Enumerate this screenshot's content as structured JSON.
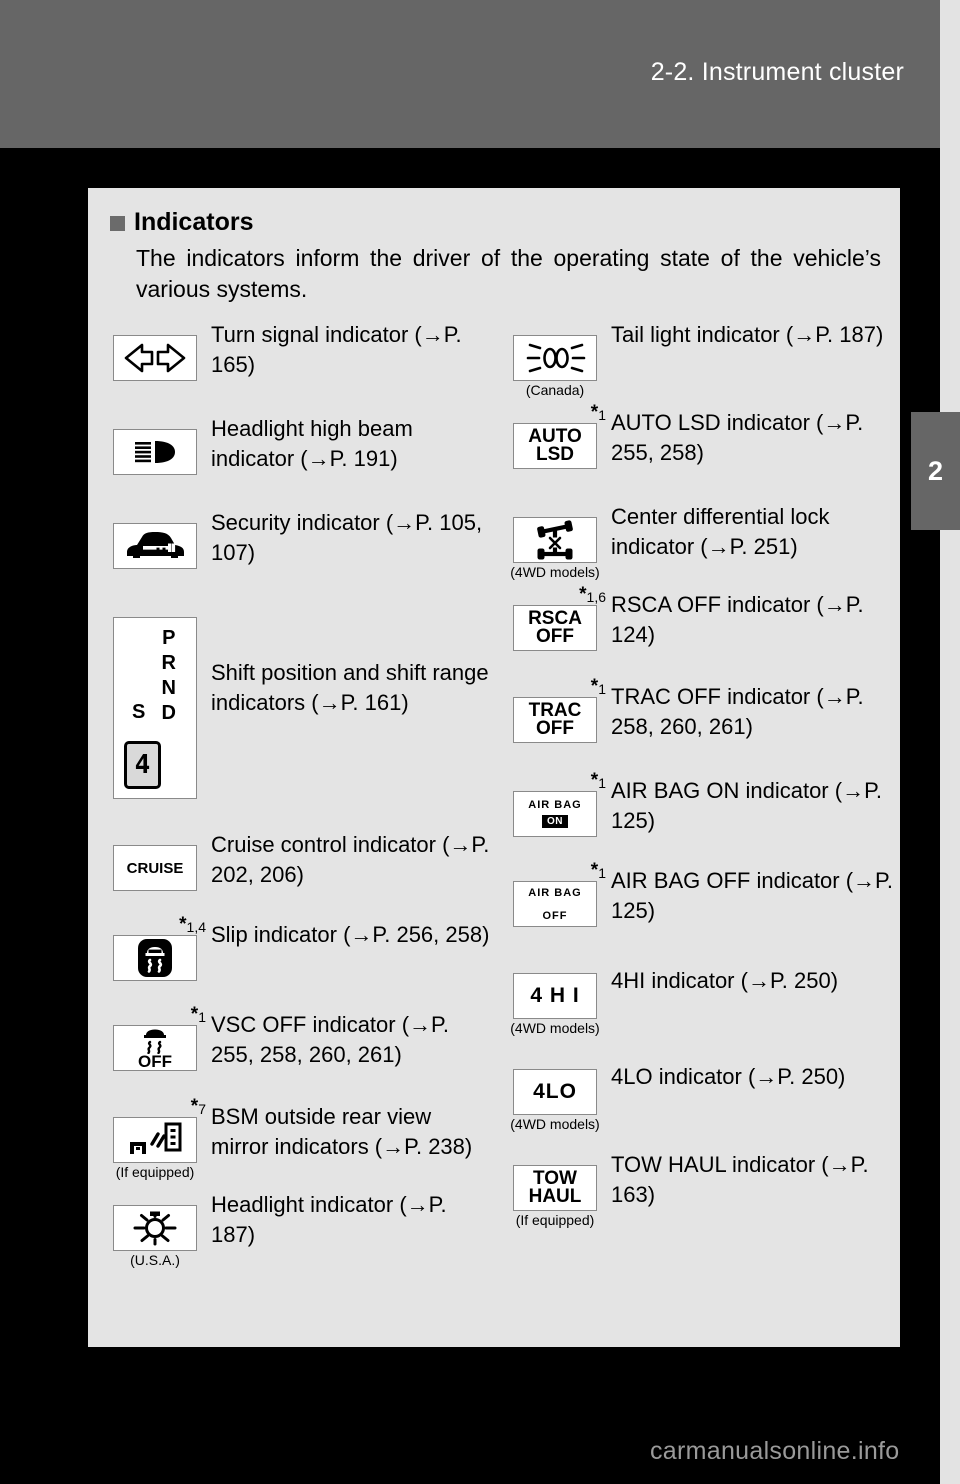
{
  "header": {
    "title": "2-2. Instrument cluster",
    "chapter_number": "2"
  },
  "section": {
    "title": "Indicators",
    "body": "The indicators inform the driver of the operating state of the vehicle’s various systems."
  },
  "left_column": [
    {
      "icon": "turn-signal-icon",
      "note": "",
      "sub": "",
      "label": "Turn signal indicator (→P. 165)"
    },
    {
      "icon": "high-beam-icon",
      "note": "",
      "sub": "",
      "label": "Headlight high beam indicator (→P. 191)"
    },
    {
      "icon": "security-icon",
      "note": "",
      "sub": "",
      "label": "Security indicator (→P. 105, 107)"
    },
    {
      "icon": "shift-position-icon",
      "note": "",
      "sub": "",
      "label": "Shift position and shift range indicators (→P. 161)",
      "glyph_letters": "P\nR\nN\nD",
      "glyph_s": "S",
      "glyph_gear": "4"
    },
    {
      "icon": "cruise-icon",
      "note": "",
      "sub": "",
      "label": "Cruise control indicator (→P. 202, 206)",
      "glyph_text": "CRUISE"
    },
    {
      "icon": "slip-icon",
      "note": "1,4",
      "sub": "",
      "label": "Slip indicator (→P. 256, 258)"
    },
    {
      "icon": "vsc-off-icon",
      "note": "1",
      "sub": "",
      "label": "VSC OFF indicator (→P. 255, 258, 260, 261)",
      "glyph_text": "OFF"
    },
    {
      "icon": "bsm-mirror-icon",
      "note": "7",
      "sub": "(If equipped)",
      "label": "BSM outside rear view mirror indicators (→P. 238)"
    },
    {
      "icon": "headlight-icon",
      "note": "",
      "sub": "(U.S.A.)",
      "label": "Headlight indicator (→P. 187)"
    }
  ],
  "right_column": [
    {
      "icon": "tail-light-icon",
      "note": "",
      "sub": "(Canada)",
      "label": "Tail light indicator (→P. 187)"
    },
    {
      "icon": "auto-lsd-icon",
      "note": "1",
      "sub": "",
      "label": "AUTO LSD indicator (→P. 255, 258)",
      "glyph_line1": "AUTO",
      "glyph_line2": "LSD"
    },
    {
      "icon": "center-diff-lock-icon",
      "note": "",
      "sub": "(4WD models)",
      "label": "Center differential lock indicator (→P. 251)"
    },
    {
      "icon": "rsca-off-icon",
      "note": "1,6",
      "sub": "",
      "label": "RSCA OFF indicator (→P. 124)",
      "glyph_line1": "RSCA",
      "glyph_line2": "OFF"
    },
    {
      "icon": "trac-off-icon",
      "note": "1",
      "sub": "",
      "label": "TRAC OFF indicator (→P. 258, 260, 261)",
      "glyph_line1": "TRAC",
      "glyph_line2": "OFF"
    },
    {
      "icon": "air-bag-on-icon",
      "note": "1",
      "sub": "",
      "label": "AIR BAG ON indicator (→P. 125)",
      "glyph_line1": "AIR BAG",
      "glyph_line2": "ON"
    },
    {
      "icon": "air-bag-off-icon",
      "note": "1",
      "sub": "",
      "label": "AIR BAG OFF indicator (→P. 125)",
      "glyph_line1": "AIR BAG",
      "glyph_line2": "OFF"
    },
    {
      "icon": "four-hi-icon",
      "note": "",
      "sub": "(4WD models)",
      "label": "4HI indicator (→P. 250)",
      "glyph_text": "4 H I"
    },
    {
      "icon": "four-lo-icon",
      "note": "",
      "sub": "(4WD models)",
      "label": "4LO indicator (→P. 250)",
      "glyph_text": "4LO"
    },
    {
      "icon": "tow-haul-icon",
      "note": "",
      "sub": "(If equipped)",
      "label": "TOW HAUL indicator (→P. 163)",
      "glyph_line1": "TOW",
      "glyph_line2": "HAUL"
    }
  ],
  "watermark": "carmanualsonline.info",
  "colors": {
    "band": "#666666",
    "panel": "#e4e4e4",
    "page": "#000000",
    "edge": "#e3e3e3"
  }
}
